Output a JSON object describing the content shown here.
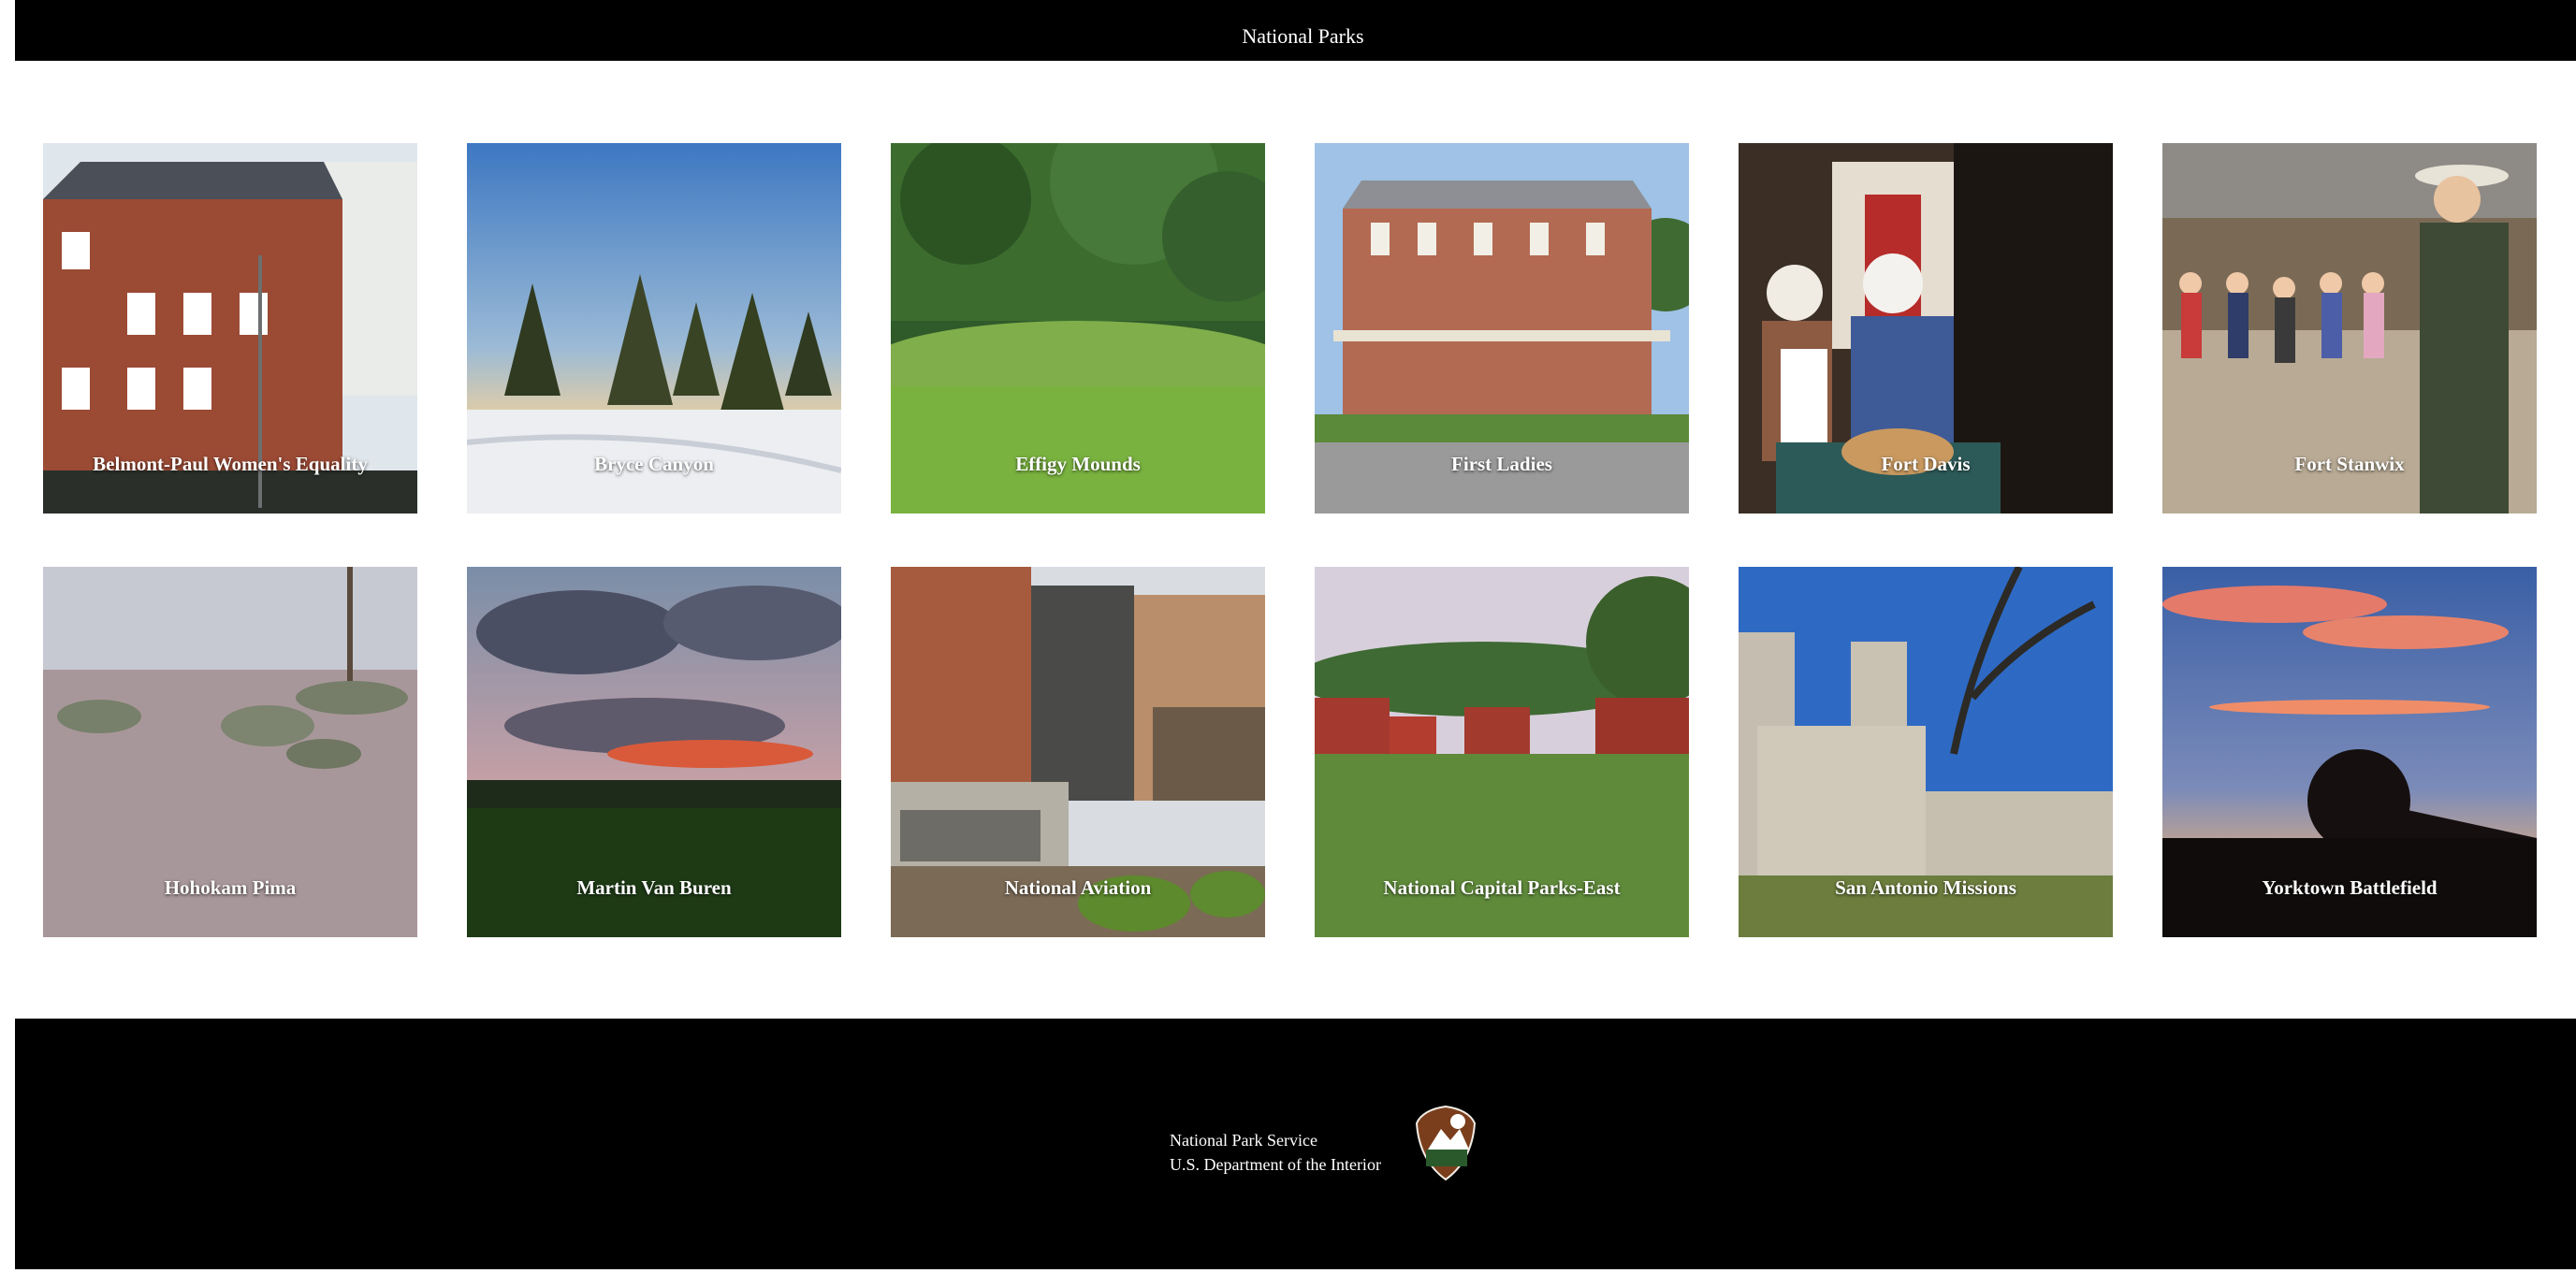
{
  "header": {
    "title": "National Parks"
  },
  "parks": [
    {
      "name": "Belmont-Paul Women's Equality",
      "scene": "brick-building"
    },
    {
      "name": "Bryce Canyon",
      "scene": "snowy-pines"
    },
    {
      "name": "Effigy Mounds",
      "scene": "green-mounds"
    },
    {
      "name": "First Ladies",
      "scene": "victorian-house"
    },
    {
      "name": "Fort Davis",
      "scene": "reenactors-kitchen"
    },
    {
      "name": "Fort Stanwix",
      "scene": "ranger-and-children"
    },
    {
      "name": "Hohokam Pima",
      "scene": "desert"
    },
    {
      "name": "Martin Van Buren",
      "scene": "sunset-clouds"
    },
    {
      "name": "National Aviation",
      "scene": "visitor-center"
    },
    {
      "name": "National Capital Parks-East",
      "scene": "red-barns"
    },
    {
      "name": "San Antonio Missions",
      "scene": "mission-church"
    },
    {
      "name": "Yorktown Battlefield",
      "scene": "cannon-silhouette"
    }
  ],
  "footer": {
    "line1": "National Park Service",
    "line2": "U.S. Department of the Interior",
    "logo": "nps-arrowhead-icon"
  },
  "colors": {
    "header_bg": "#000000",
    "footer_bg": "#000000",
    "label_text": "#ffffff",
    "arrowhead_brown": "#7a3e1c"
  }
}
